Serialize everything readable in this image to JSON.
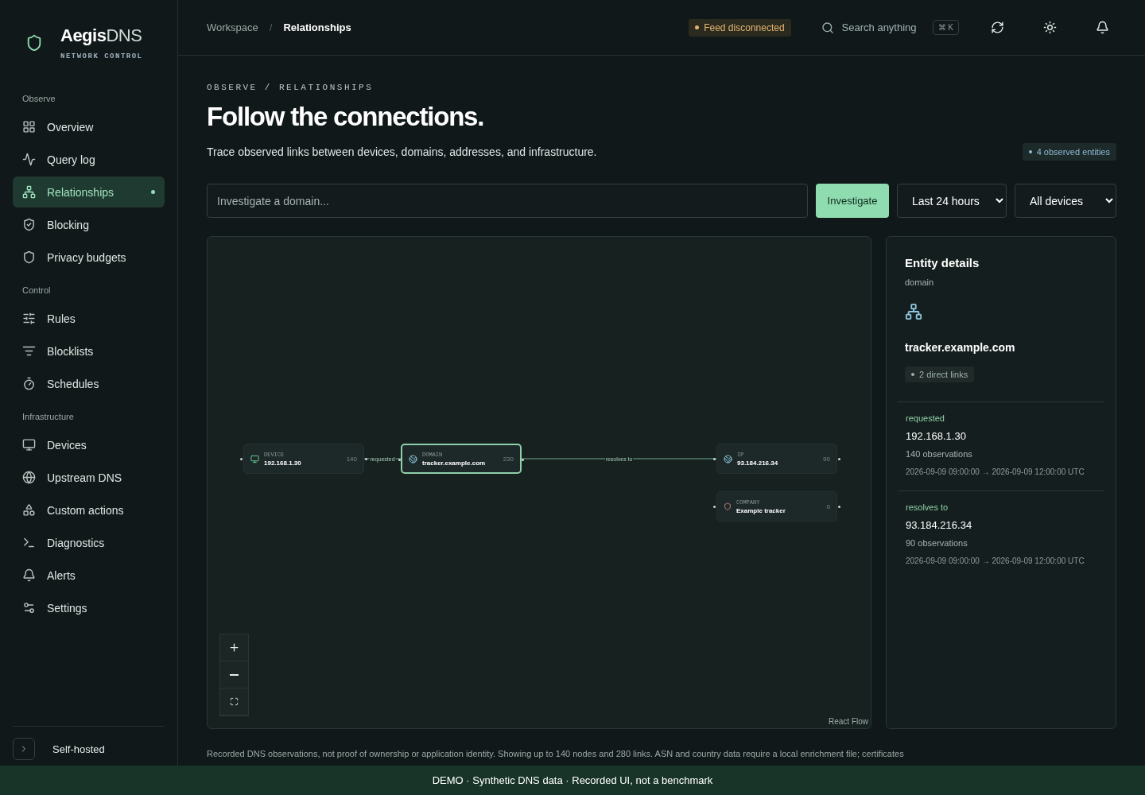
{
  "brand": {
    "name_bold": "Aegis",
    "name_light": "DNS",
    "tagline": "NETWORK CONTROL"
  },
  "sidebar": {
    "groups": [
      {
        "title": "Observe",
        "items": [
          {
            "label": "Overview",
            "selected": false
          },
          {
            "label": "Query log",
            "selected": false
          },
          {
            "label": "Relationships",
            "selected": true
          },
          {
            "label": "Blocking",
            "selected": false
          },
          {
            "label": "Privacy budgets",
            "selected": false
          }
        ]
      },
      {
        "title": "Control",
        "items": [
          {
            "label": "Rules",
            "selected": false
          },
          {
            "label": "Blocklists",
            "selected": false
          },
          {
            "label": "Schedules",
            "selected": false
          }
        ]
      },
      {
        "title": "Infrastructure",
        "items": [
          {
            "label": "Devices",
            "selected": false
          },
          {
            "label": "Upstream DNS",
            "selected": false
          },
          {
            "label": "Custom actions",
            "selected": false
          },
          {
            "label": "Diagnostics",
            "selected": false
          },
          {
            "label": "Alerts",
            "selected": false
          },
          {
            "label": "Settings",
            "selected": false
          }
        ]
      }
    ],
    "footer": "Self-hosted"
  },
  "header": {
    "breadcrumb": [
      "Workspace",
      "Relationships"
    ],
    "separator": "/",
    "status": "Feed disconnected",
    "search_placeholder": "Search anything",
    "shortcut": "⌘ K"
  },
  "page": {
    "eyebrow": "OBSERVE / RELATIONSHIPS",
    "title": "Follow the connections.",
    "subtitle": "Trace observed links between devices, domains, addresses, and infrastructure.",
    "entity_count": "4 observed entities"
  },
  "controls": {
    "placeholder": "Investigate a domain...",
    "button": "Investigate",
    "range": "Last 24 hours",
    "devices": "All devices"
  },
  "graph": {
    "nodes": [
      {
        "kind": "device",
        "type": "DEVICE",
        "name": "192.168.1.30",
        "count": "140",
        "selected": false
      },
      {
        "kind": "domain",
        "type": "DOMAIN",
        "name": "tracker.example.com",
        "count": "230",
        "selected": true
      },
      {
        "kind": "ip",
        "type": "IP",
        "name": "93.184.216.34",
        "count": "90",
        "selected": false
      },
      {
        "kind": "company",
        "type": "COMPANY",
        "name": "Example tracker",
        "count": "0",
        "selected": false
      }
    ],
    "edges": [
      {
        "label": "requested"
      },
      {
        "label": "resolves to"
      }
    ],
    "attribution": "React Flow"
  },
  "details": {
    "title": "Entity details",
    "kind": "domain",
    "name": "tracker.example.com",
    "links_badge": "2 direct links",
    "links": [
      {
        "relation": "requested",
        "target": "192.168.1.30",
        "observations": "140 observations",
        "range": "2026-09-09 09:00:00 → 2026-09-09 12:00:00 UTC"
      },
      {
        "relation": "resolves to",
        "target": "93.184.216.34",
        "observations": "90 observations",
        "range": "2026-09-09 09:00:00 → 2026-09-09 12:00:00 UTC"
      }
    ]
  },
  "footnote": "Recorded DNS observations, not proof of ownership or application identity. Showing up to 140 nodes and 280 links. ASN and country data require a local enrichment file; certificates",
  "demo_bar": "DEMO · Synthetic DNS data · Recorded UI, not a benchmark"
}
